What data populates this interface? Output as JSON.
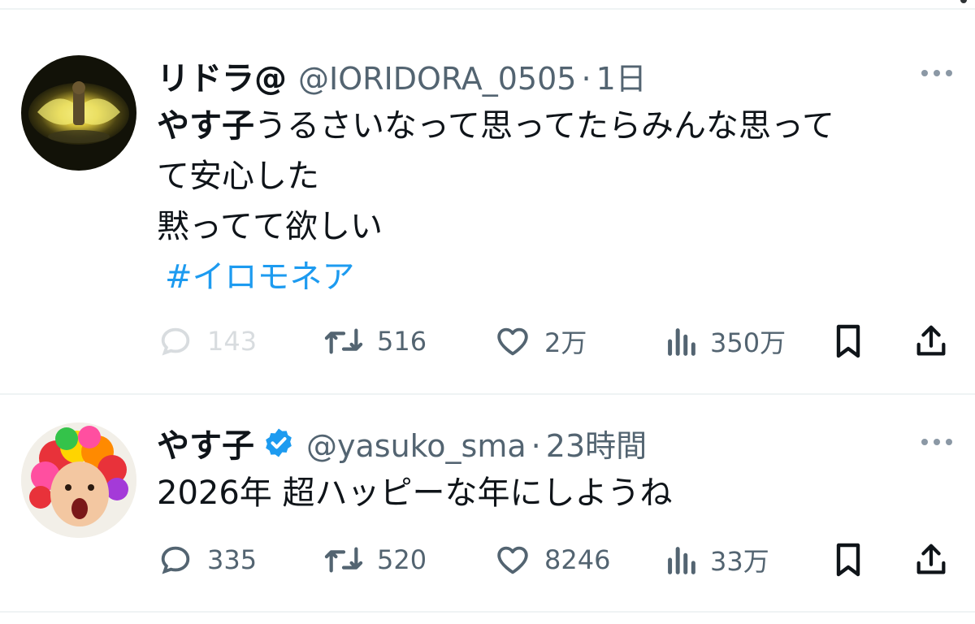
{
  "tweets": [
    {
      "name": "リドラ@",
      "handle": "@IORIDORA_0505",
      "separator": "·",
      "time": "1日",
      "verified": false,
      "text_bold": "やす子",
      "text_line1_rest": "うるさいなって思ってたらみんな思って",
      "text_line2": "て安心した",
      "text_line3": "黙ってて欲しい",
      "hashtag": "#イロモネア",
      "replies": "143",
      "retweets": "516",
      "likes": "2万",
      "views": "350万"
    },
    {
      "name": "やす子",
      "handle": "@yasuko_sma",
      "separator": "·",
      "time": "23時間",
      "verified": true,
      "text": "2026年 超ハッピーな年にしようね",
      "replies": "335",
      "retweets": "520",
      "likes": "8246",
      "views": "33万"
    }
  ],
  "colors": {
    "text": "#0f1419",
    "secondary": "#536471",
    "link": "#1d9bf0",
    "verified": "#1d9bf0",
    "divider": "#eff3f4"
  },
  "icons": {
    "reply": "speech-bubble-icon",
    "retweet": "retweet-arrows-icon",
    "like": "heart-icon",
    "views": "bar-chart-icon",
    "bookmark": "bookmark-icon",
    "share": "share-upload-icon",
    "more": "more-dots-icon",
    "verified": "verified-badge-icon"
  }
}
